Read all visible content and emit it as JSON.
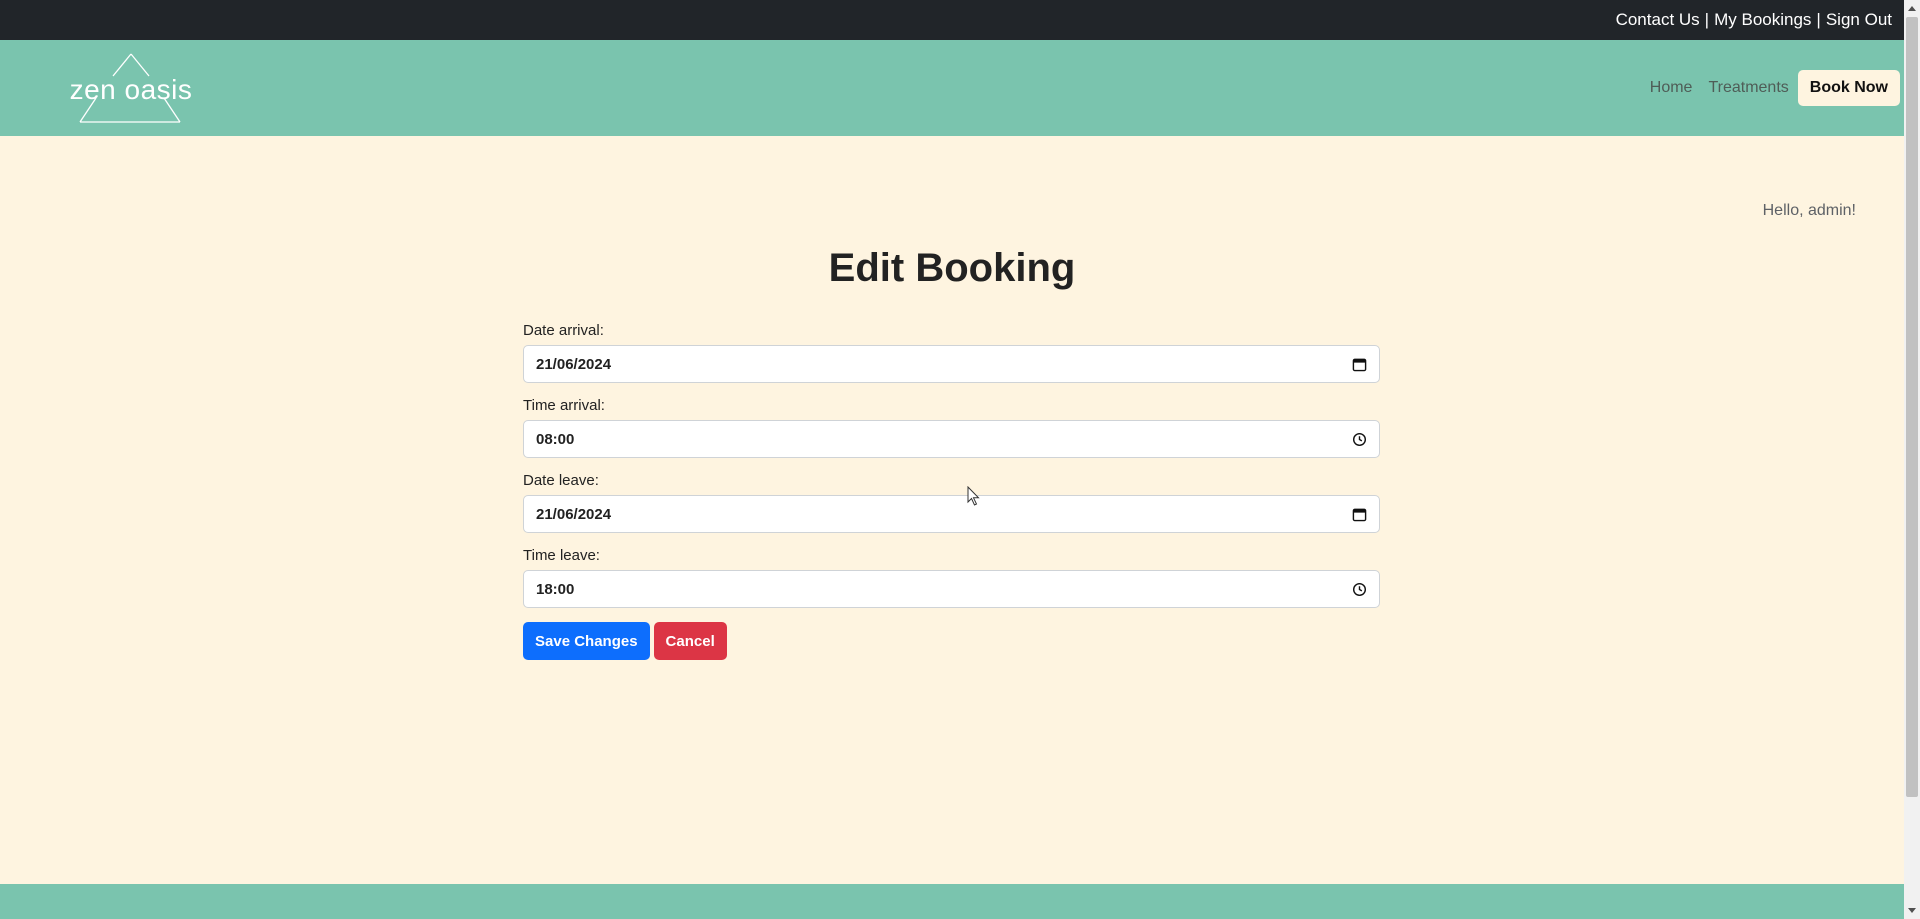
{
  "topbar": {
    "links": [
      {
        "label": "Contact Us"
      },
      {
        "label": "My Bookings"
      },
      {
        "label": "Sign Out"
      }
    ],
    "separator": "|"
  },
  "brand": {
    "logo_text": "zen oasis"
  },
  "nav": {
    "home": "Home",
    "treatments": "Treatments",
    "book_now": "Book Now"
  },
  "greeting": "Hello, admin!",
  "page_title": "Edit Booking",
  "form": {
    "fields": [
      {
        "label": "Date arrival:",
        "value": "21/06/2024",
        "icon": "calendar-icon"
      },
      {
        "label": "Time arrival:",
        "value": "08:00",
        "icon": "clock-icon"
      },
      {
        "label": "Date leave:",
        "value": "21/06/2024",
        "icon": "calendar-icon"
      },
      {
        "label": "Time leave:",
        "value": "18:00",
        "icon": "clock-icon"
      }
    ],
    "save_label": "Save Changes",
    "cancel_label": "Cancel"
  },
  "colors": {
    "topbar": "#212529",
    "brand": "#7ac4ae",
    "background": "#fef4e0",
    "primary": "#0d6efd",
    "danger": "#dc3545"
  }
}
